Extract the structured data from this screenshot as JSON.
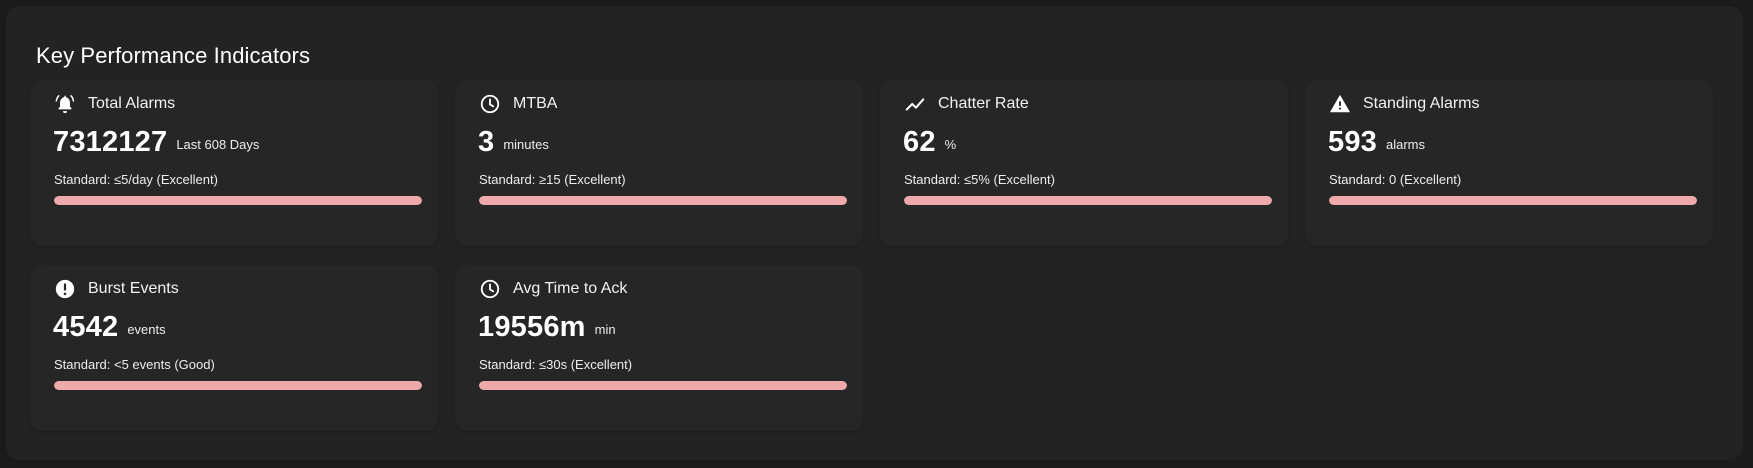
{
  "panel": {
    "title": "Key Performance Indicators"
  },
  "colors": {
    "background": "#1b1b1b",
    "panel": "#232323",
    "card": "#262626",
    "bar_fill": "#eeaaaa"
  },
  "kpis": [
    {
      "title": "Total Alarms",
      "icon": "alarm-bell-icon",
      "value": "7312127",
      "unit": "Last 608 Days",
      "standard": "Standard: ≤5/day (Excellent)",
      "progress": 1.0
    },
    {
      "title": "MTBA",
      "icon": "clock-icon",
      "value": "3",
      "unit": "minutes",
      "standard": "Standard: ≥15 (Excellent)",
      "progress": 1.0
    },
    {
      "title": "Chatter Rate",
      "icon": "trend-line-icon",
      "value": "62",
      "unit": "%",
      "standard": "Standard: ≤5% (Excellent)",
      "progress": 1.0
    },
    {
      "title": "Standing Alarms",
      "icon": "warning-triangle-icon",
      "value": "593",
      "unit": "alarms",
      "standard": "Standard: 0 (Excellent)",
      "progress": 1.0
    },
    {
      "title": "Burst Events",
      "icon": "exclamation-circle-icon",
      "value": "4542",
      "unit": "events",
      "standard": "Standard: <5 events (Good)",
      "progress": 1.0
    },
    {
      "title": "Avg Time to Ack",
      "icon": "clock-icon",
      "value": "19556m",
      "unit": "min",
      "standard": "Standard: ≤30s (Excellent)",
      "progress": 1.0
    }
  ]
}
